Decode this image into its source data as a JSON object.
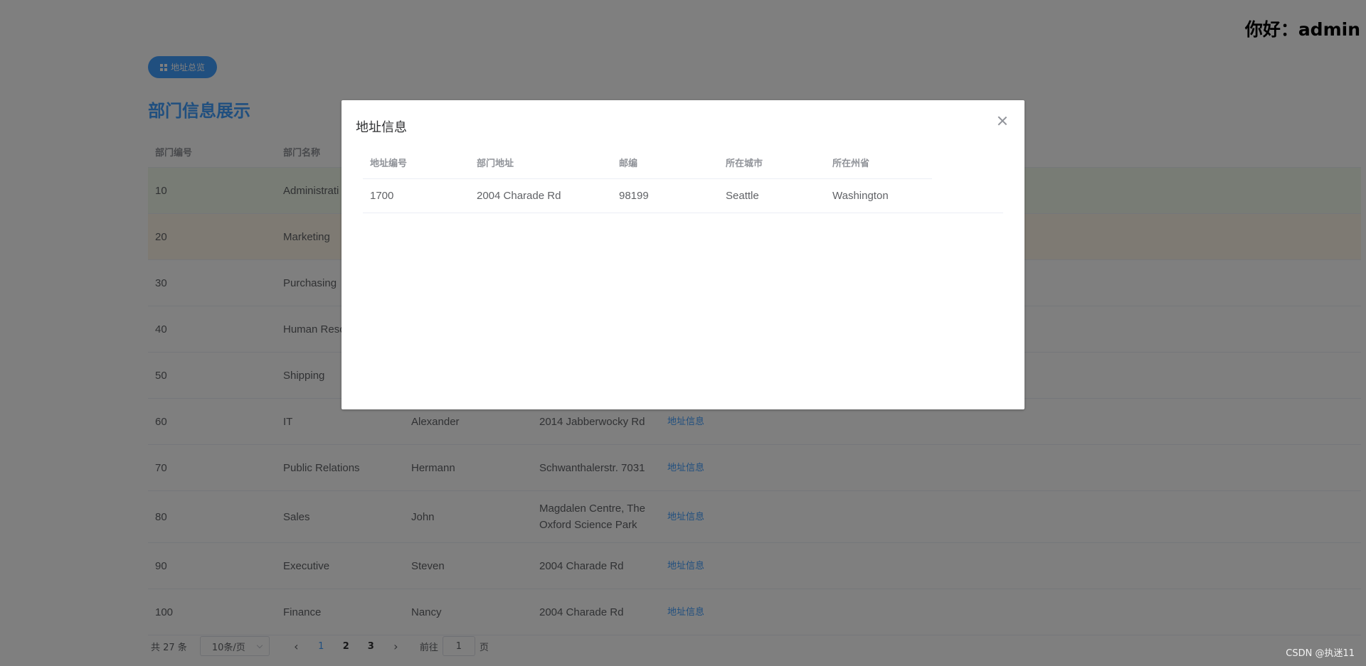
{
  "header": {
    "greeting": "你好：admin"
  },
  "toolbar": {
    "overview_label": "地址总览"
  },
  "page": {
    "title": "部门信息展示"
  },
  "table": {
    "headers": [
      "部门编号",
      "部门名称",
      "",
      "",
      ""
    ],
    "rows": [
      {
        "id": "10",
        "name": "Administrati",
        "manager": "",
        "address": "",
        "action": ""
      },
      {
        "id": "20",
        "name": "Marketing",
        "manager": "",
        "address": "",
        "action": ""
      },
      {
        "id": "30",
        "name": "Purchasing",
        "manager": "",
        "address": "",
        "action": ""
      },
      {
        "id": "40",
        "name": "Human Resc",
        "manager": "",
        "address": "",
        "action": ""
      },
      {
        "id": "50",
        "name": "Shipping",
        "manager": "",
        "address": "",
        "action": ""
      },
      {
        "id": "60",
        "name": "IT",
        "manager": "Alexander",
        "address": "2014 Jabberwocky Rd",
        "action": "地址信息"
      },
      {
        "id": "70",
        "name": "Public Relations",
        "manager": "Hermann",
        "address": "Schwanthalerstr. 7031",
        "action": "地址信息"
      },
      {
        "id": "80",
        "name": "Sales",
        "manager": "John",
        "address": "Magdalen Centre, The Oxford Science Park",
        "action": "地址信息"
      },
      {
        "id": "90",
        "name": "Executive",
        "manager": "Steven",
        "address": "2004 Charade Rd",
        "action": "地址信息"
      },
      {
        "id": "100",
        "name": "Finance",
        "manager": "Nancy",
        "address": "2004 Charade Rd",
        "action": "地址信息"
      }
    ]
  },
  "pagination": {
    "total": "共 27 条",
    "page_size": "10条/页",
    "prev": "‹",
    "next": "›",
    "pages": [
      "1",
      "2",
      "3"
    ],
    "current": "1",
    "goto_label": "前往",
    "goto_value": "1",
    "goto_suffix": "页"
  },
  "dialog": {
    "title": "地址信息",
    "headers": [
      "地址编号",
      "部门地址",
      "邮编",
      "所在城市",
      "所在州省"
    ],
    "row": [
      "1700",
      "2004 Charade Rd",
      "98199",
      "Seattle",
      "Washington"
    ]
  },
  "watermark": "CSDN @执迷11"
}
